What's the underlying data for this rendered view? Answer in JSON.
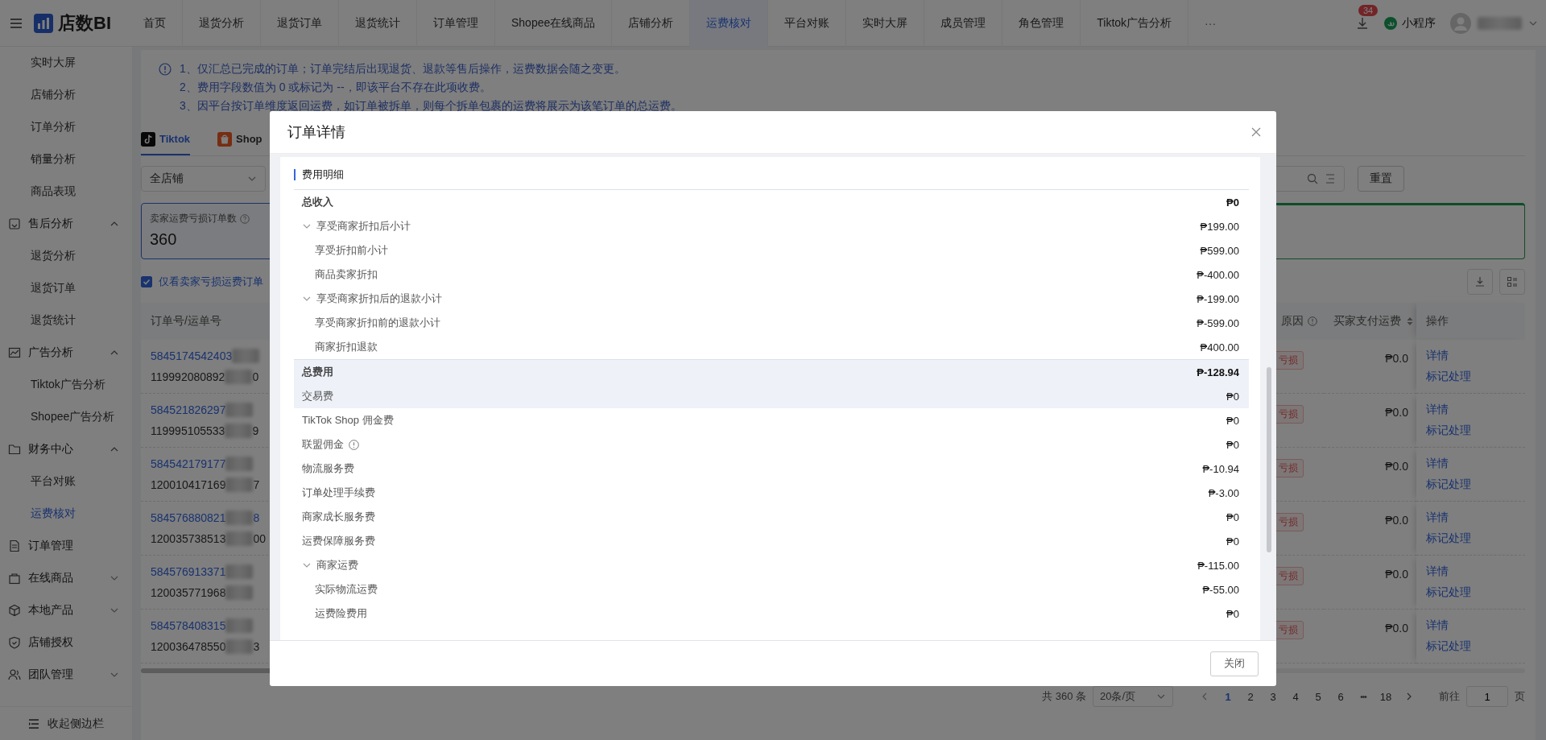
{
  "header": {
    "logo": "店数BI",
    "nav": [
      {
        "label": "首页",
        "selected": false
      },
      {
        "label": "退货分析",
        "selected": false
      },
      {
        "label": "退货订单",
        "selected": false
      },
      {
        "label": "退货统计",
        "selected": false
      },
      {
        "label": "订单管理",
        "selected": false
      },
      {
        "label": "Shopee在线商品",
        "selected": false
      },
      {
        "label": "店铺分析",
        "selected": false
      },
      {
        "label": "运费核对",
        "selected": true
      },
      {
        "label": "平台对账",
        "selected": false
      },
      {
        "label": "实时大屏",
        "selected": false
      },
      {
        "label": "成员管理",
        "selected": false
      },
      {
        "label": "角色管理",
        "selected": false
      },
      {
        "label": "Tiktok广告分析",
        "selected": false
      }
    ],
    "more": "···",
    "download_badge": "34",
    "mini_program": "小程序"
  },
  "sidebar": {
    "scrolled_children": [
      {
        "label": "实时大屏",
        "selected": false
      },
      {
        "label": "店铺分析",
        "selected": false
      },
      {
        "label": "订单分析",
        "selected": false
      },
      {
        "label": "销量分析",
        "selected": false
      },
      {
        "label": "商品表现",
        "selected": false
      }
    ],
    "items": [
      {
        "label": "售后分析",
        "expanded": true,
        "selected": false,
        "children": [
          {
            "label": "退货分析",
            "selected": false
          },
          {
            "label": "退货订单",
            "selected": false
          },
          {
            "label": "退货统计",
            "selected": false
          }
        ]
      },
      {
        "label": "广告分析",
        "expanded": true,
        "selected": false,
        "children": [
          {
            "label": "Tiktok广告分析",
            "selected": false
          },
          {
            "label": "Shopee广告分析",
            "selected": false
          }
        ]
      },
      {
        "label": "财务中心",
        "expanded": true,
        "selected": false,
        "children": [
          {
            "label": "平台对账",
            "selected": false
          },
          {
            "label": "运费核对",
            "selected": true
          }
        ]
      },
      {
        "label": "订单管理",
        "selected": false
      },
      {
        "label": "在线商品",
        "expanded": false,
        "selected": false
      },
      {
        "label": "本地产品",
        "expanded": false,
        "selected": false
      },
      {
        "label": "店铺授权",
        "selected": false
      },
      {
        "label": "团队管理",
        "expanded": false,
        "selected": false
      }
    ],
    "collapse_button": "收起侧边栏"
  },
  "notice": [
    "1、仅汇总已完成的订单；订单完结后出现退货、退款等售后操作，运费数据会随之变更。",
    "2、费用字段数值为 0 或标记为 --，即该平台不存在此项收费。",
    "3、因平台按订单维度返回运费，如订单被拆单，则每个拆单包裹的运费将展示为该笔订单的总运费。"
  ],
  "platform_tabs": [
    {
      "label": "Tiktok",
      "selected": true
    },
    {
      "label": "Shop",
      "selected": false
    }
  ],
  "store_select": {
    "value": "全店铺"
  },
  "reset_button": "重置",
  "stat_cards": [
    {
      "title": "卖家运费亏损订单数",
      "value": "360",
      "selected": true
    }
  ],
  "only_loss_checkbox": {
    "label": "仅看卖家亏损运费订单",
    "checked": true
  },
  "table": {
    "columns": [
      "订单号/运单号",
      "原因",
      "买家支付运费",
      "操作"
    ],
    "rows": [
      {
        "order_no": "5845174542403",
        "order_tail": "",
        "tracking_no": "119992080892",
        "tracking_tail": "0",
        "tag": "亏损",
        "buyer_paid": "₱0.0",
        "actions": [
          "详情",
          "标记处理"
        ]
      },
      {
        "order_no": "584521826297",
        "order_tail": "",
        "tracking_no": "119995105533",
        "tracking_tail": "9",
        "tag": "亏损",
        "buyer_paid": "₱0.0",
        "actions": [
          "详情",
          "标记处理"
        ]
      },
      {
        "order_no": "584542179177",
        "order_tail": "",
        "tracking_no": "120010417169",
        "tracking_tail": "7",
        "tag": "亏损",
        "buyer_paid": "₱0.0",
        "actions": [
          "详情",
          "标记处理"
        ]
      },
      {
        "order_no": "584576880821",
        "order_tail": "8",
        "tracking_no": "120035738513",
        "tracking_tail": "00",
        "tag": "亏损",
        "buyer_paid": "₱0.0",
        "actions": [
          "详情",
          "标记处理"
        ]
      },
      {
        "order_no": "584576913371",
        "order_tail": "",
        "tracking_no": "120035771968",
        "tracking_tail": "",
        "tag": "亏损",
        "buyer_paid": "₱0.0",
        "actions": [
          "详情",
          "标记处理"
        ]
      },
      {
        "order_no": "584578408315",
        "order_tail": "",
        "tracking_no": "120036478550",
        "tracking_tail": "3",
        "tag": "亏损",
        "buyer_paid": "₱0.0",
        "actions": [
          "详情",
          "标记处理"
        ]
      }
    ]
  },
  "pagination": {
    "total": "共 360 条",
    "page_size": "20条/页",
    "pages": [
      {
        "kind": "page",
        "label": "1",
        "selected": true
      },
      {
        "kind": "page",
        "label": "2",
        "selected": false
      },
      {
        "kind": "page",
        "label": "3",
        "selected": false
      },
      {
        "kind": "page",
        "label": "4",
        "selected": false
      },
      {
        "kind": "page",
        "label": "5",
        "selected": false
      },
      {
        "kind": "page",
        "label": "6",
        "selected": false
      },
      {
        "kind": "ellipsis",
        "label": "•••"
      },
      {
        "kind": "page",
        "label": "18",
        "selected": false
      }
    ],
    "goto_label": "前往",
    "goto_value": "1",
    "page_suffix": "页"
  },
  "modal": {
    "title": "订单详情",
    "section_title": "费用明细",
    "close_button": "关闭",
    "sections": [
      {
        "rows": [
          {
            "kind": "total",
            "label": "总收入",
            "value": "₱0",
            "highlighted": false,
            "info": false
          },
          {
            "kind": "group",
            "label": "享受商家折扣后小计",
            "value": "₱199.00",
            "expanded": true,
            "highlighted": false,
            "info": false,
            "children": [
              {
                "label": "享受折扣前小计",
                "value": "₱599.00"
              },
              {
                "label": "商品卖家折扣",
                "value": "₱-400.00"
              }
            ]
          },
          {
            "kind": "group",
            "label": "享受商家折扣后的退款小计",
            "value": "₱-199.00",
            "expanded": true,
            "highlighted": false,
            "info": false,
            "children": [
              {
                "label": "享受商家折扣前的退款小计",
                "value": "₱-599.00"
              },
              {
                "label": "商家折扣退款",
                "value": "₱400.00"
              }
            ]
          }
        ]
      },
      {
        "rows": [
          {
            "kind": "total",
            "label": "总费用",
            "value": "₱-128.94",
            "highlighted": true,
            "info": false
          },
          {
            "kind": "item",
            "label": "交易费",
            "value": "₱0",
            "highlighted": true,
            "info": false
          },
          {
            "kind": "item",
            "label": "TikTok Shop 佣金费",
            "value": "₱0",
            "highlighted": false,
            "info": false
          },
          {
            "kind": "item",
            "label": "联盟佣金",
            "value": "₱0",
            "highlighted": false,
            "info": true
          },
          {
            "kind": "item",
            "label": "物流服务费",
            "value": "₱-10.94",
            "highlighted": false,
            "info": false
          },
          {
            "kind": "item",
            "label": "订单处理手续费",
            "value": "₱-3.00",
            "highlighted": false,
            "info": false
          },
          {
            "kind": "item",
            "label": "商家成长服务费",
            "value": "₱0",
            "highlighted": false,
            "info": false
          },
          {
            "kind": "item",
            "label": "运费保障服务费",
            "value": "₱0",
            "highlighted": false,
            "info": false
          },
          {
            "kind": "group",
            "label": "商家运费",
            "value": "₱-115.00",
            "expanded": true,
            "highlighted": false,
            "info": false,
            "children": [
              {
                "label": "实际物流运费",
                "value": "₱-55.00"
              },
              {
                "label": "运费险费用",
                "value": "₱0"
              }
            ]
          }
        ]
      }
    ]
  }
}
